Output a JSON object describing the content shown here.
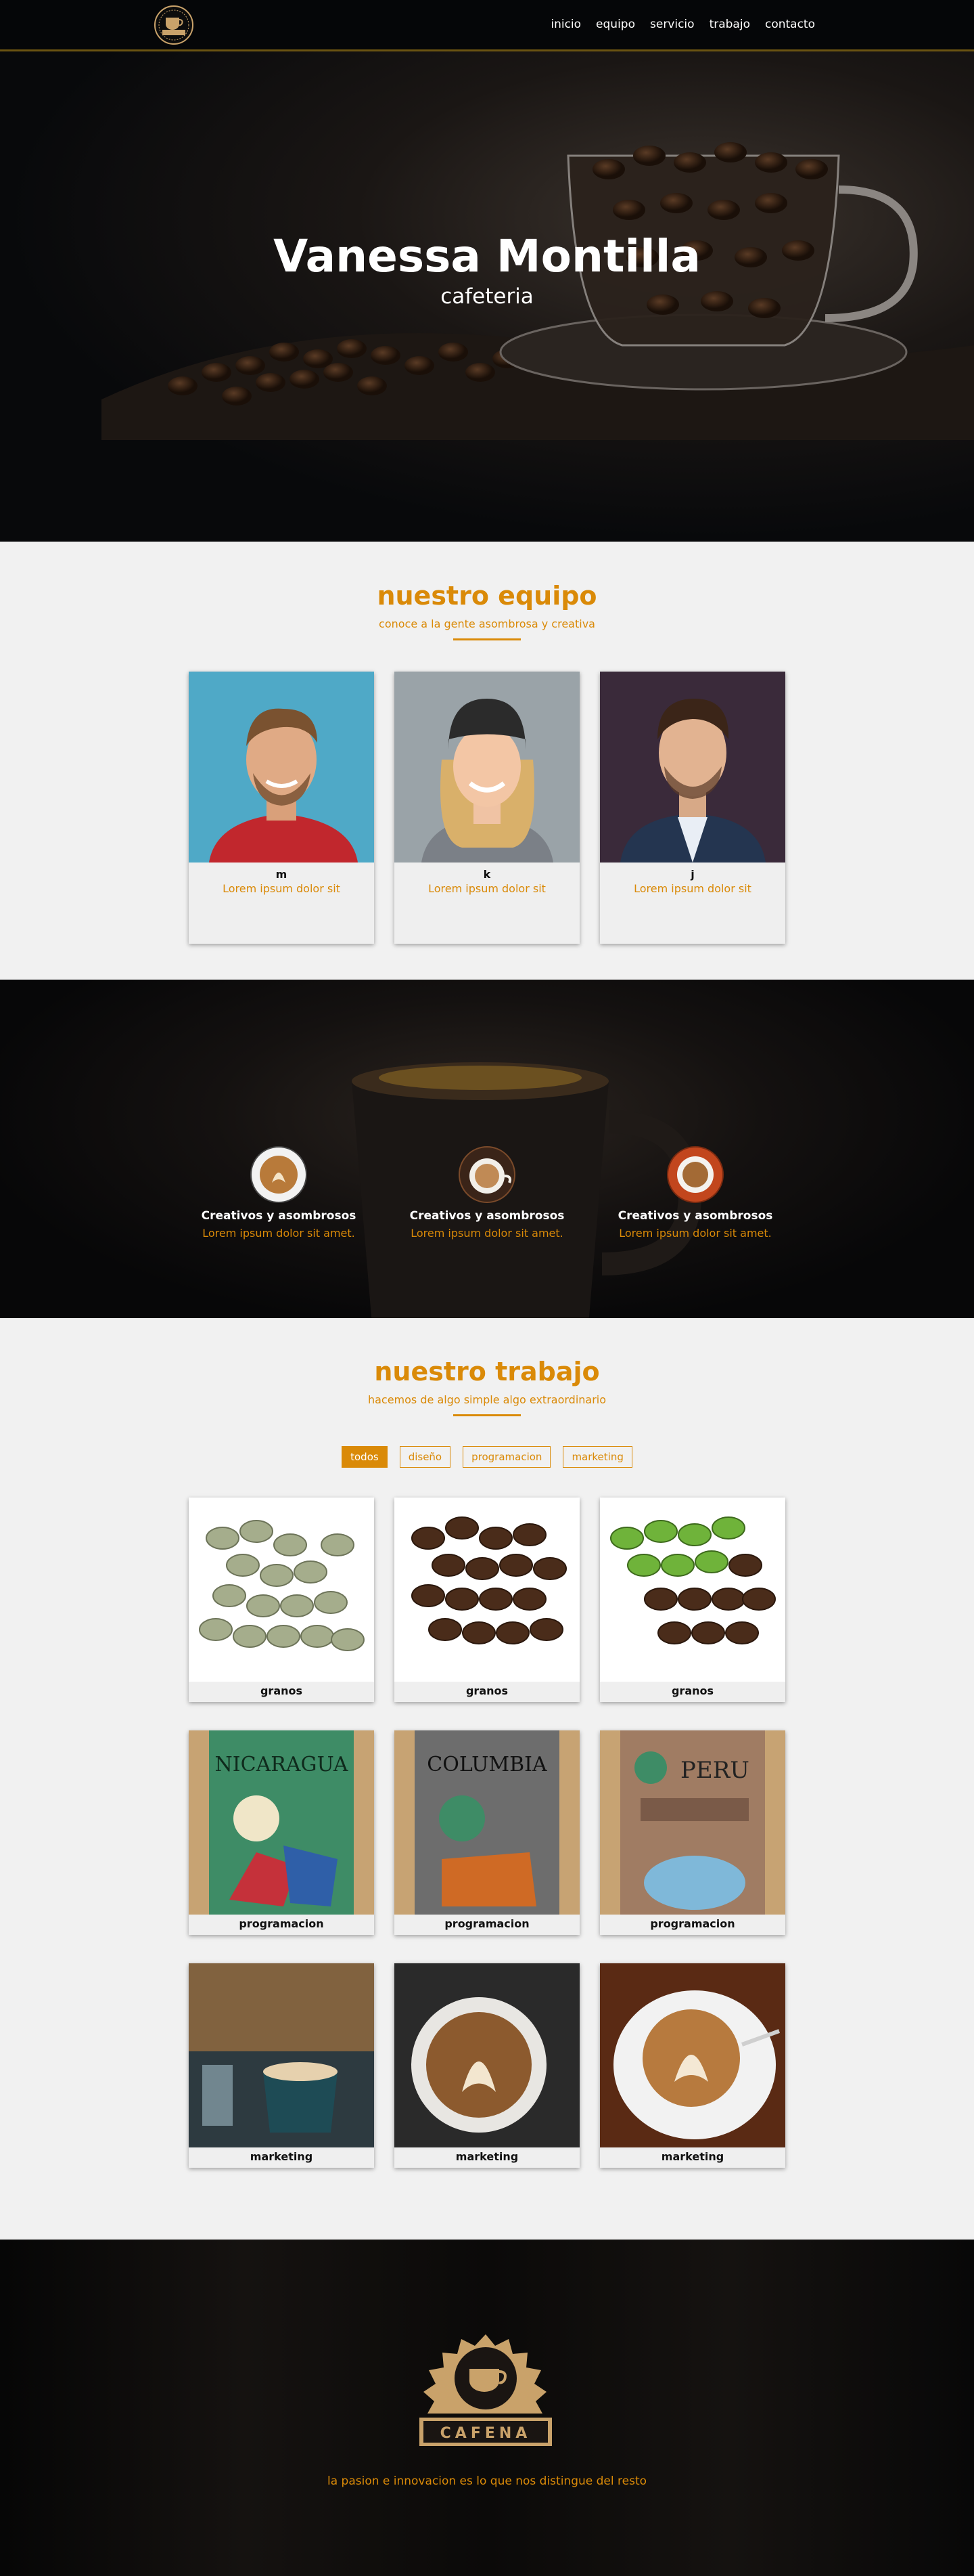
{
  "nav": {
    "logo_text": "CAFENA",
    "items": [
      {
        "label": "inicio"
      },
      {
        "label": "equipo"
      },
      {
        "label": "servicio"
      },
      {
        "label": "trabajo"
      },
      {
        "label": "contacto"
      }
    ]
  },
  "hero": {
    "title": "Vanessa Montilla",
    "subtitle": "cafeteria"
  },
  "team": {
    "title": "nuestro equipo",
    "subtitle": "conoce a la gente asombrosa y creativa",
    "members": [
      {
        "name": "m",
        "desc": "Lorem ipsum dolor sit"
      },
      {
        "name": "k",
        "desc": "Lorem ipsum dolor sit"
      },
      {
        "name": "j",
        "desc": "Lorem ipsum dolor sit"
      }
    ]
  },
  "services": {
    "items": [
      {
        "title": "Creativos y asombrosos",
        "desc": "Lorem ipsum dolor sit amet."
      },
      {
        "title": "Creativos y asombrosos",
        "desc": "Lorem ipsum dolor sit amet."
      },
      {
        "title": "Creativos y asombrosos",
        "desc": "Lorem ipsum dolor sit amet."
      }
    ]
  },
  "work": {
    "title": "nuestro trabajo",
    "subtitle": "hacemos de algo simple algo extraordinario",
    "filters": [
      {
        "label": "todos",
        "active": true
      },
      {
        "label": "diseño",
        "active": false
      },
      {
        "label": "programacion",
        "active": false
      },
      {
        "label": "marketing",
        "active": false
      }
    ],
    "items": [
      {
        "label": "granos"
      },
      {
        "label": "granos"
      },
      {
        "label": "granos"
      },
      {
        "label": "programacion",
        "pack": "NICARAGUA"
      },
      {
        "label": "programacion",
        "pack": "COLUMBIA"
      },
      {
        "label": "programacion",
        "pack": "PERU"
      },
      {
        "label": "marketing"
      },
      {
        "label": "marketing"
      },
      {
        "label": "marketing"
      }
    ]
  },
  "footer": {
    "logo_text": "CAFENA",
    "tagline": "la pasion e innovacion es lo que nos distingue del resto"
  },
  "colors": {
    "accent": "#da8a08",
    "nav_bg": "#050608",
    "section_bg": "#f1f1f1"
  }
}
